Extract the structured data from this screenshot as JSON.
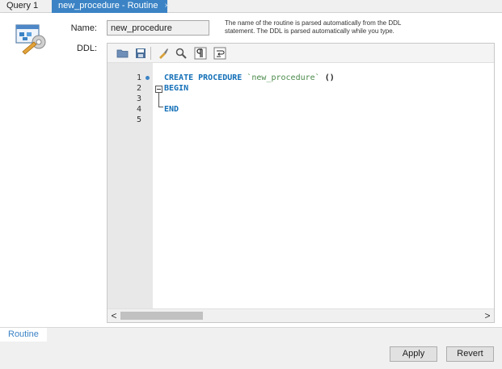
{
  "tabs": [
    {
      "label": "Query 1",
      "active": false
    },
    {
      "label": "new_procedure - Routine",
      "active": true,
      "close": "×"
    }
  ],
  "form": {
    "name_label": "Name:",
    "name_value": "new_procedure",
    "hint": "The name of the routine is parsed automatically from the DDL statement. The DDL is parsed automatically while you type.",
    "ddl_label": "DDL:"
  },
  "editor": {
    "line_numbers": [
      "1",
      "2",
      "3",
      "4",
      "5"
    ],
    "code": {
      "line1_kw": "CREATE PROCEDURE",
      "line1_name": "`new_procedure`",
      "line1_parens": "()",
      "line2": "BEGIN",
      "line4": "END"
    },
    "toolbar_icons": [
      "open-folder-icon",
      "save-icon",
      "beautify-brush-icon",
      "find-magnifier-icon",
      "invisible-chars-pilcrow-icon",
      "word-wrap-icon"
    ],
    "scroll_left": "<",
    "scroll_right": ">"
  },
  "subtabs": [
    {
      "label": "Routine",
      "active": true
    }
  ],
  "buttons": {
    "apply": "Apply",
    "revert": "Revert"
  },
  "colors": {
    "accent": "#3b83c5",
    "keyword": "#1470b8",
    "string": "#4a8a4a"
  }
}
